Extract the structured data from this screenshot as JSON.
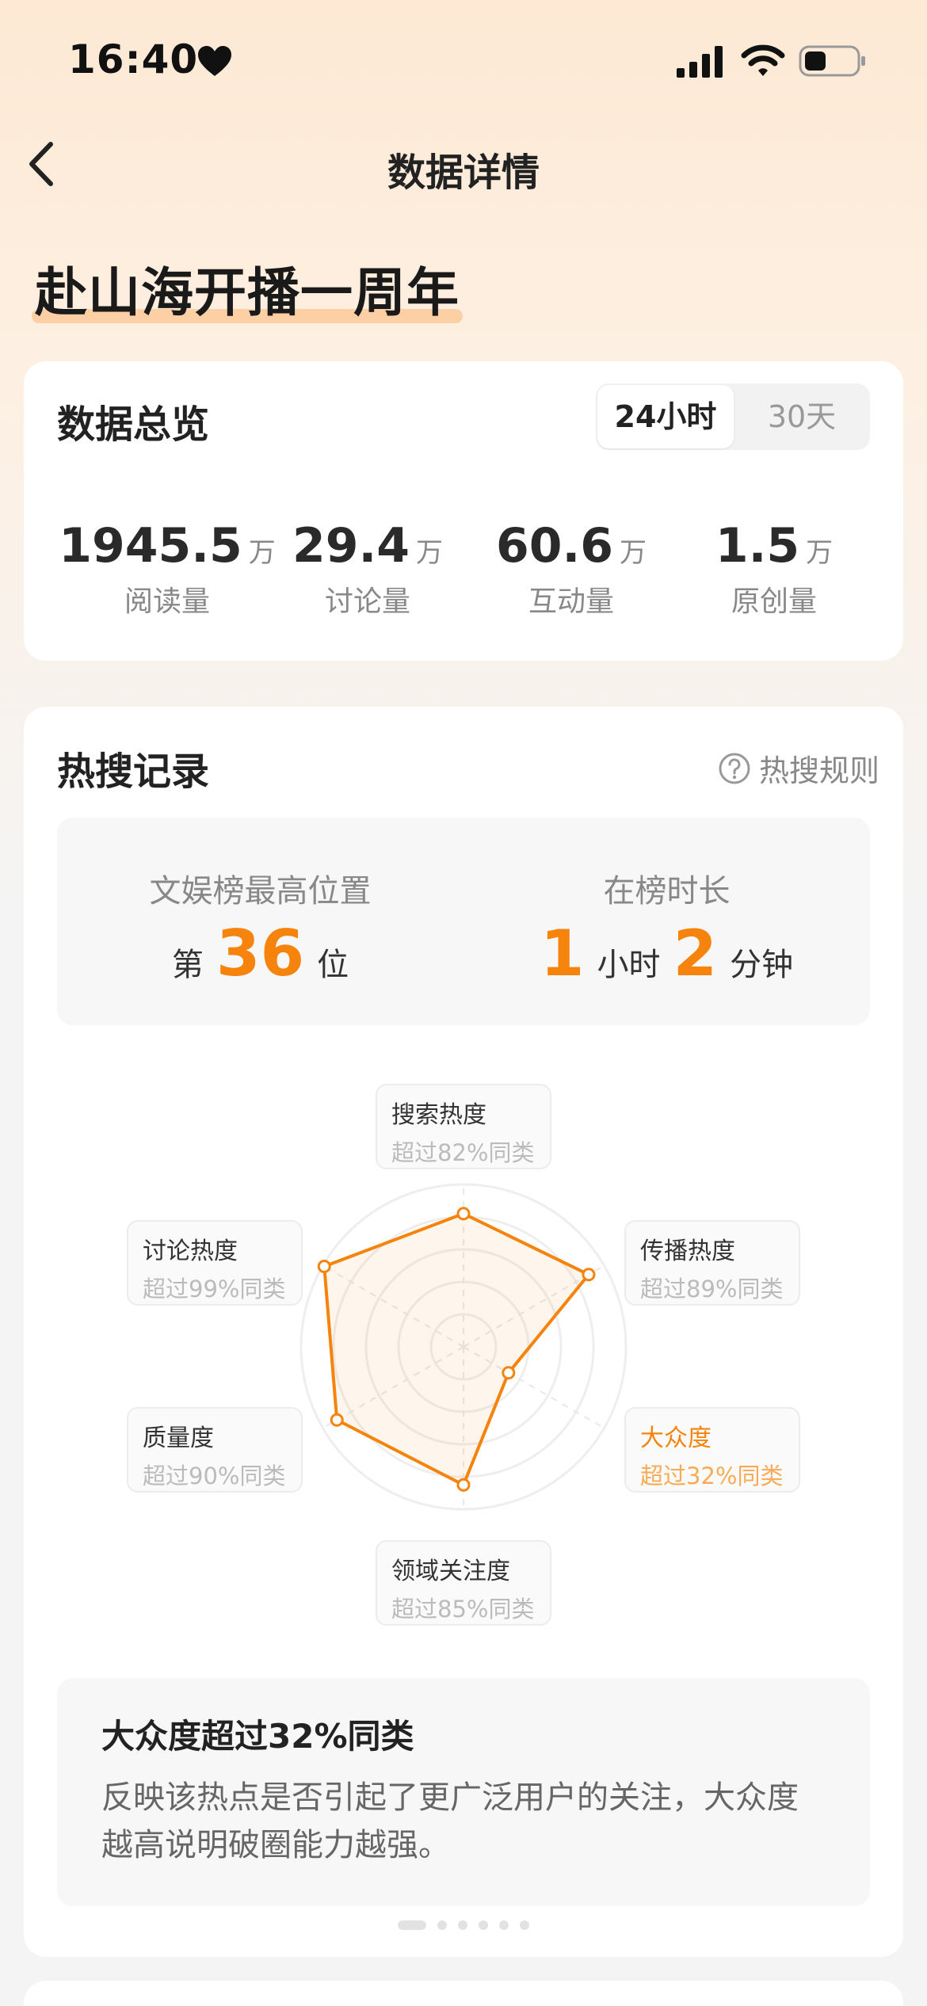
{
  "status_bar": {
    "time": "16:40"
  },
  "nav": {
    "title": "数据详情"
  },
  "event": {
    "title": "赴山海开播一周年"
  },
  "overview": {
    "heading": "数据总览",
    "range_options": [
      "24小时",
      "30天"
    ],
    "selected_range": "24小时",
    "stats": [
      {
        "value": "1945.5",
        "unit": "万",
        "label": "阅读量"
      },
      {
        "value": "29.4",
        "unit": "万",
        "label": "讨论量"
      },
      {
        "value": "60.6",
        "unit": "万",
        "label": "互动量"
      },
      {
        "value": "1.5",
        "unit": "万",
        "label": "原创量"
      }
    ]
  },
  "hot_search": {
    "heading": "热搜记录",
    "rules_label": "热搜规则",
    "rank": {
      "label": "文娱榜最高位置",
      "prefix": "第",
      "value": "36",
      "suffix": "位"
    },
    "duration": {
      "label": "在榜时长",
      "hours": "1",
      "hours_unit": "小时",
      "minutes": "2",
      "minutes_unit": "分钟"
    },
    "radar": {
      "dimensions": [
        {
          "name": "搜索热度",
          "desc": "超过82%同类",
          "percent": 82,
          "active": false
        },
        {
          "name": "传播热度",
          "desc": "超过89%同类",
          "percent": 89,
          "active": false
        },
        {
          "name": "大众度",
          "desc": "超过32%同类",
          "percent": 32,
          "active": true
        },
        {
          "name": "领域关注度",
          "desc": "超过85%同类",
          "percent": 85,
          "active": false
        },
        {
          "name": "质量度",
          "desc": "超过90%同类",
          "percent": 90,
          "active": false
        },
        {
          "name": "讨论热度",
          "desc": "超过99%同类",
          "percent": 99,
          "active": false
        }
      ],
      "accent_color": "#f6830c"
    },
    "explain": {
      "title": "大众度超过32%同类",
      "text": "反映该热点是否引起了更广泛用户的关注，大众度越高说明破圈能力越强。"
    }
  }
}
